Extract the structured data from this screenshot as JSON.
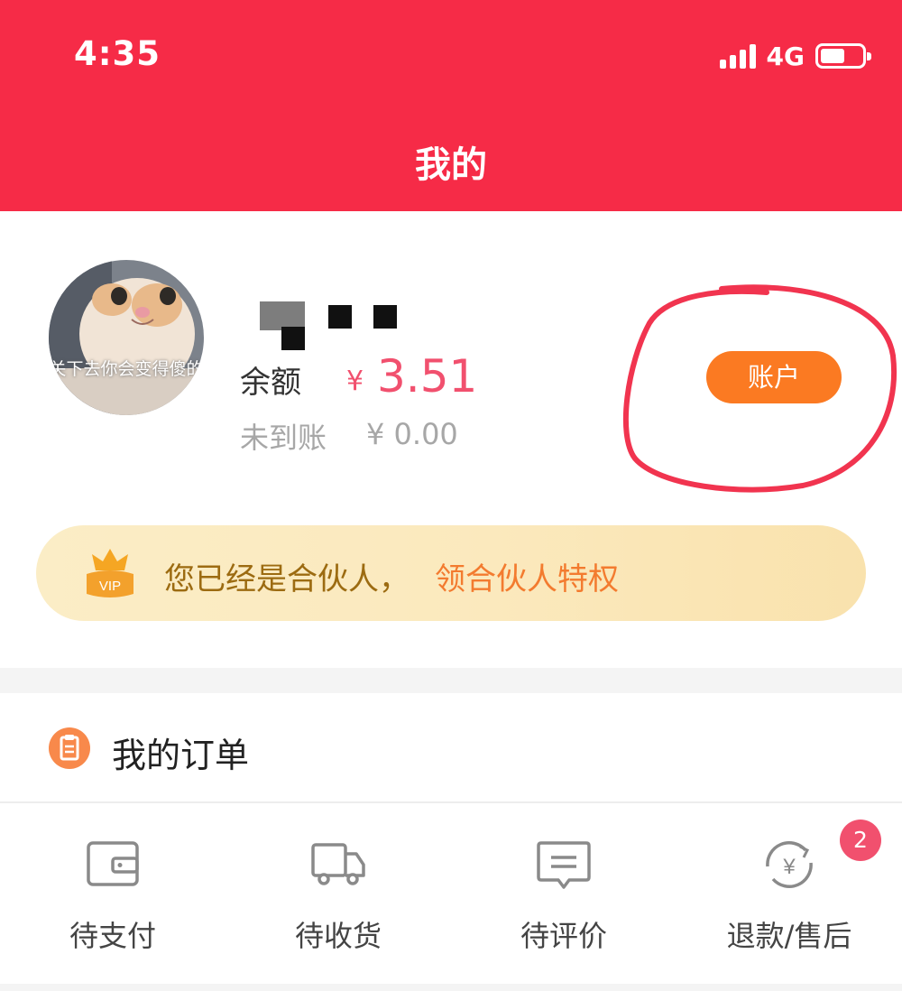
{
  "status_bar": {
    "time": "4:35",
    "network": "4G"
  },
  "header": {
    "title": "我的",
    "color": "#f62b47"
  },
  "profile": {
    "avatar_caption": "关下去你会变得傻的",
    "balance_label": "余额",
    "currency_symbol": "¥",
    "balance_value": "3.51",
    "pending_label": "未到账",
    "pending_value": "¥ 0.00",
    "account_button": "账户",
    "accent": "#f1506e",
    "button_color": "#fb7a22"
  },
  "vip_banner": {
    "badge": "VIP",
    "text": "您已经是合伙人，",
    "link": "领合伙人特权"
  },
  "orders": {
    "title": "我的订单",
    "items": [
      {
        "label": "待支付",
        "icon": "wallet-icon"
      },
      {
        "label": "待收货",
        "icon": "truck-icon"
      },
      {
        "label": "待评价",
        "icon": "message-icon"
      },
      {
        "label": "退款/售后",
        "icon": "refund-icon",
        "badge": "2"
      }
    ]
  }
}
